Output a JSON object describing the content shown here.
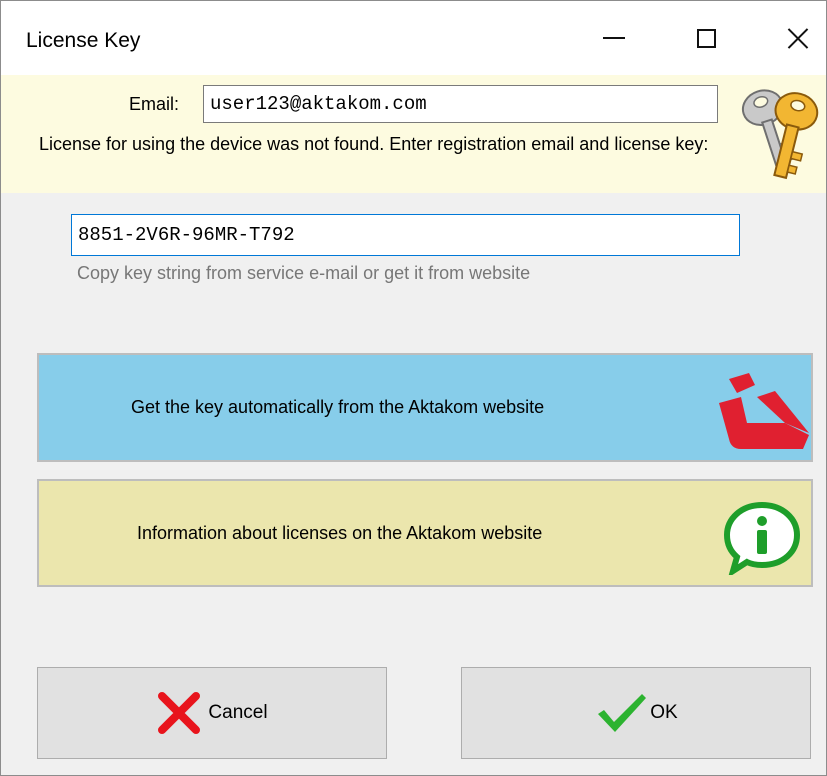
{
  "window": {
    "title": "License Key"
  },
  "form": {
    "email_label": "Email:",
    "email_value": "user123@aktakom.com",
    "license_message": "License for using the device was not found. Enter registration email and license key:",
    "key_value": "8851-2V6R-96MR-T792",
    "key_hint": "Copy key string from service e-mail or get it from website"
  },
  "actions": {
    "get_key_label": "Get the key automatically from the Aktakom website",
    "info_label": "Information about licenses on the Aktakom website",
    "cancel_label": "Cancel",
    "ok_label": "OK"
  },
  "icons": {
    "keys": "keys-icon",
    "aktakom_logo": "aktakom-logo-icon",
    "info": "info-bubble-icon",
    "cancel": "red-x-icon",
    "ok": "green-check-icon"
  },
  "colors": {
    "header_band": "#fdfbe0",
    "aktakom_button": "#87cdea",
    "info_button": "#ebe6ad",
    "aktakom_red": "#e02030",
    "info_green": "#1e9e2a",
    "input_focus": "#0078d7"
  }
}
